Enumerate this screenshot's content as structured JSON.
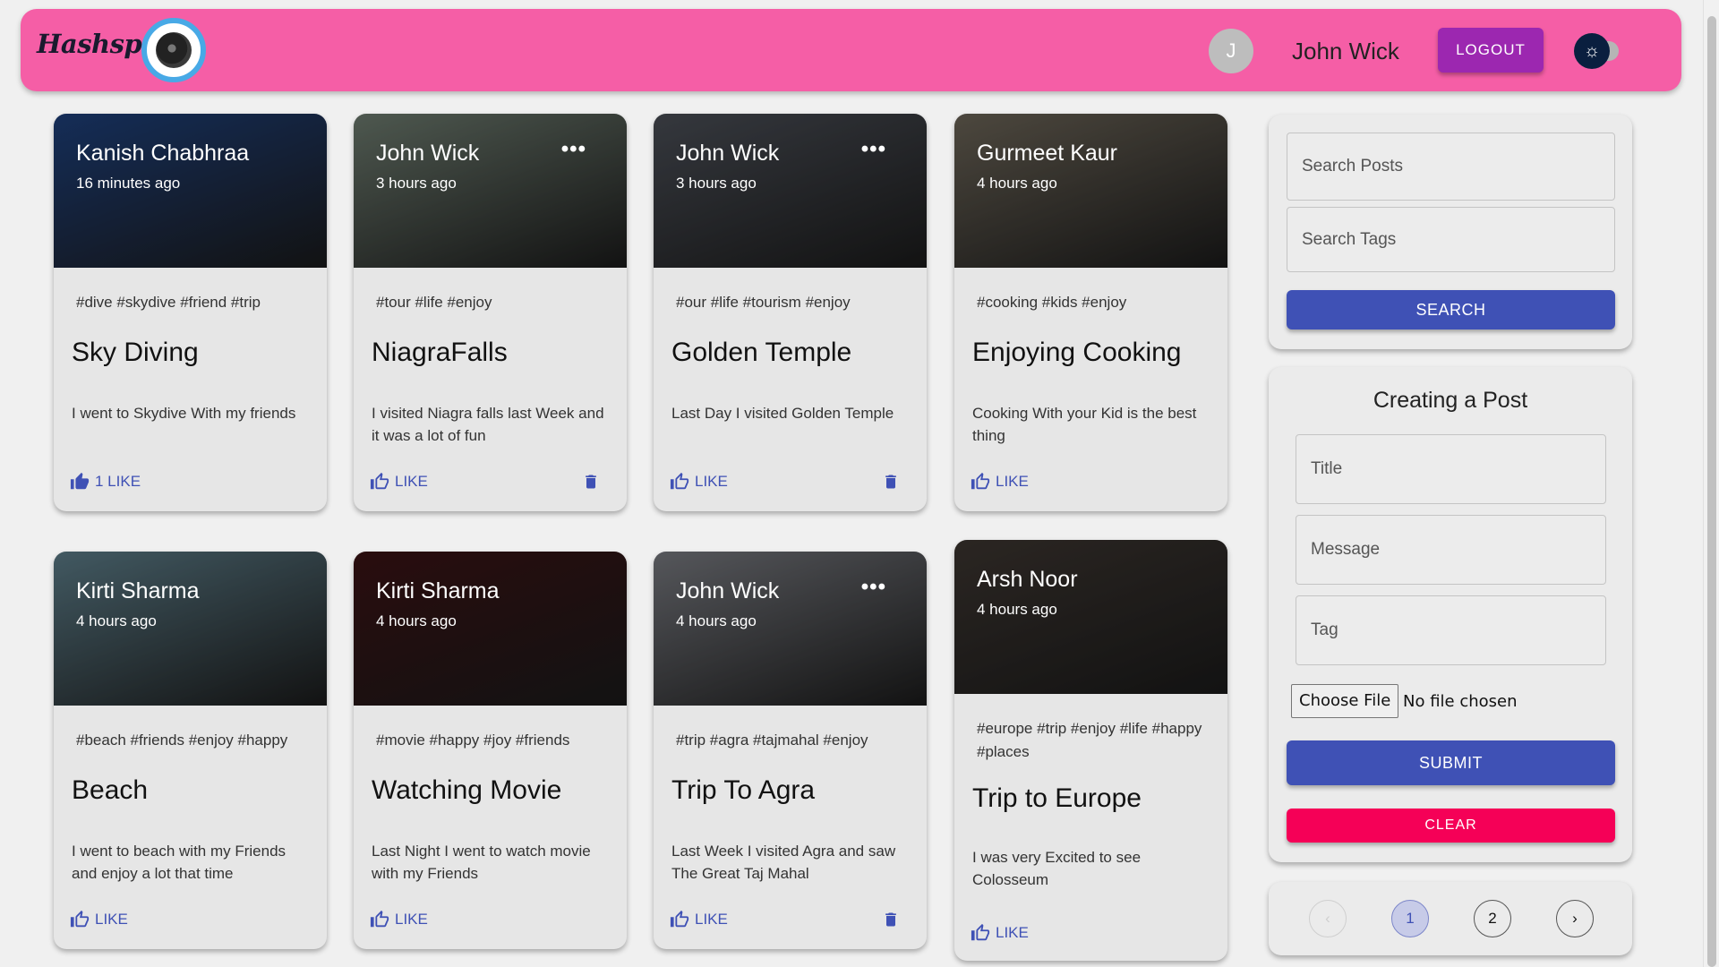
{
  "header": {
    "brand": "Hashspot",
    "avatar_letter": "J",
    "username": "John Wick",
    "logout_label": "LOGOUT"
  },
  "posts": [
    {
      "author": "Kanish Chabhraa",
      "time": "16 minutes ago",
      "tags": "#dive #skydive #friend #trip",
      "title": "Sky Diving",
      "message": "I went to Skydive With my friends",
      "like": "1 LIKE",
      "own": false,
      "more": false
    },
    {
      "author": "John Wick",
      "time": "3 hours ago",
      "tags": "#tour #life #enjoy",
      "title": "NiagraFalls",
      "message": "I visited Niagra falls last Week and it was a lot of fun",
      "like": "LIKE",
      "own": true,
      "more": true
    },
    {
      "author": "John Wick",
      "time": "3 hours ago",
      "tags": "#our #life #tourism #enjoy",
      "title": "Golden Temple",
      "message": "Last Day I visited Golden Temple",
      "like": "LIKE",
      "own": true,
      "more": true
    },
    {
      "author": "Gurmeet Kaur",
      "time": "4 hours ago",
      "tags": "#cooking #kids #enjoy",
      "title": "Enjoying Cooking",
      "message": "Cooking With your Kid is the best thing",
      "like": "LIKE",
      "own": false,
      "more": false
    },
    {
      "author": "Kirti Sharma",
      "time": "4 hours ago",
      "tags": "#beach #friends #enjoy #happy",
      "title": "Beach",
      "message": "I went to beach with my Friends and enjoy a lot that time",
      "like": "LIKE",
      "own": false,
      "more": false
    },
    {
      "author": "Kirti Sharma",
      "time": "4 hours ago",
      "tags": "#movie #happy #joy #friends",
      "title": "Watching Movie",
      "message": "Last Night I went to watch movie with my Friends",
      "like": "LIKE",
      "own": false,
      "more": false
    },
    {
      "author": "John Wick",
      "time": "4 hours ago",
      "tags": "#trip #agra #tajmahal #enjoy",
      "title": "Trip To Agra",
      "message": "Last Week I visited Agra and saw The Great Taj Mahal",
      "like": "LIKE",
      "own": true,
      "more": true
    },
    {
      "author": "Arsh Noor",
      "time": "4 hours ago",
      "tags": "#europe #trip #enjoy #life #happy #places",
      "title": "Trip to Europe",
      "message": "I was very Excited to see Colosseum",
      "like": "LIKE",
      "own": false,
      "more": false
    }
  ],
  "media_colors": [
    "#1e3f7a",
    "#6d7b6f",
    "#4a4e56",
    "#6b6457",
    "#5c7c88",
    "#3a1214",
    "#77797f",
    "#3c3530"
  ],
  "search": {
    "posts_placeholder": "Search Posts",
    "tags_placeholder": "Search Tags",
    "button": "SEARCH"
  },
  "form": {
    "heading": "Creating a Post",
    "title_placeholder": "Title",
    "message_placeholder": "Message",
    "tag_placeholder": "Tag",
    "choose_file": "Choose File",
    "no_file": "No file chosen",
    "submit": "SUBMIT",
    "clear": "CLEAR"
  },
  "pagination": {
    "pages": [
      "1",
      "2"
    ],
    "current": "1",
    "prev": "‹",
    "next": "›"
  },
  "colors": {
    "header_bg": "#f55ea6",
    "logout_bg": "#9c27b0",
    "primary": "#3f51b5",
    "clear": "#f50057"
  }
}
